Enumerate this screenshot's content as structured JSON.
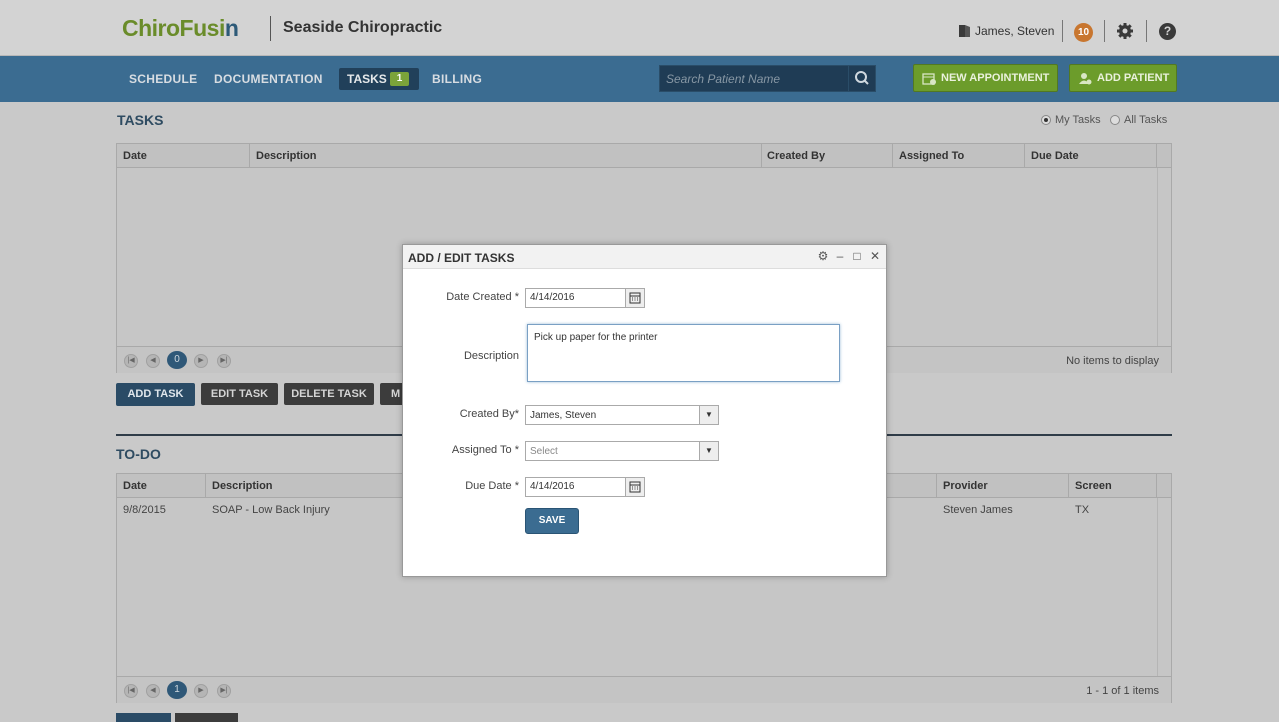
{
  "header": {
    "logo_part1": "ChiroFusi",
    "logo_part2": "n",
    "clinic_name": "Seaside Chiropractic",
    "user_name": "James, Steven",
    "notification_count": "10",
    "help_label": "?"
  },
  "nav": {
    "items": [
      "SCHEDULE",
      "DOCUMENTATION",
      "TASKS",
      "BILLING"
    ],
    "tasks_count": "1",
    "search_placeholder": "Search Patient Name",
    "new_appointment": "NEW APPOINTMENT",
    "add_patient": "ADD PATIENT"
  },
  "tasks": {
    "title": "TASKS",
    "radio_my": "My Tasks",
    "radio_all": "All Tasks",
    "columns": [
      "Date",
      "Description",
      "Created By",
      "Assigned To",
      "Due Date"
    ],
    "page": "0",
    "pager_info": "No items to display",
    "buttons": [
      "ADD TASK",
      "EDIT TASK",
      "DELETE TASK",
      "M"
    ]
  },
  "todo": {
    "title": "TO-DO",
    "columns": [
      "Date",
      "Description",
      "Provider",
      "Screen"
    ],
    "rows": [
      {
        "date": "9/8/2015",
        "description": "SOAP - Low Back Injury",
        "provider": "Steven James",
        "screen": "TX"
      }
    ],
    "page": "1",
    "pager_info": "1 - 1 of 1 items"
  },
  "modal": {
    "title": "ADD / EDIT TASKS",
    "date_created_label": "Date Created *",
    "date_created_value": "4/14/2016",
    "description_label": "Description",
    "description_value": "Pick up paper for the printer",
    "created_by_label": "Created By*",
    "created_by_value": "James, Steven",
    "assigned_to_label": "Assigned To *",
    "assigned_to_value": "Select",
    "due_date_label": "Due Date *",
    "due_date_value": "4/14/2016",
    "save_label": "SAVE"
  },
  "colors": {
    "nav_bg": "#3b6c91",
    "accent_green": "#6c9c2b",
    "badge_orange": "#c8762f"
  }
}
